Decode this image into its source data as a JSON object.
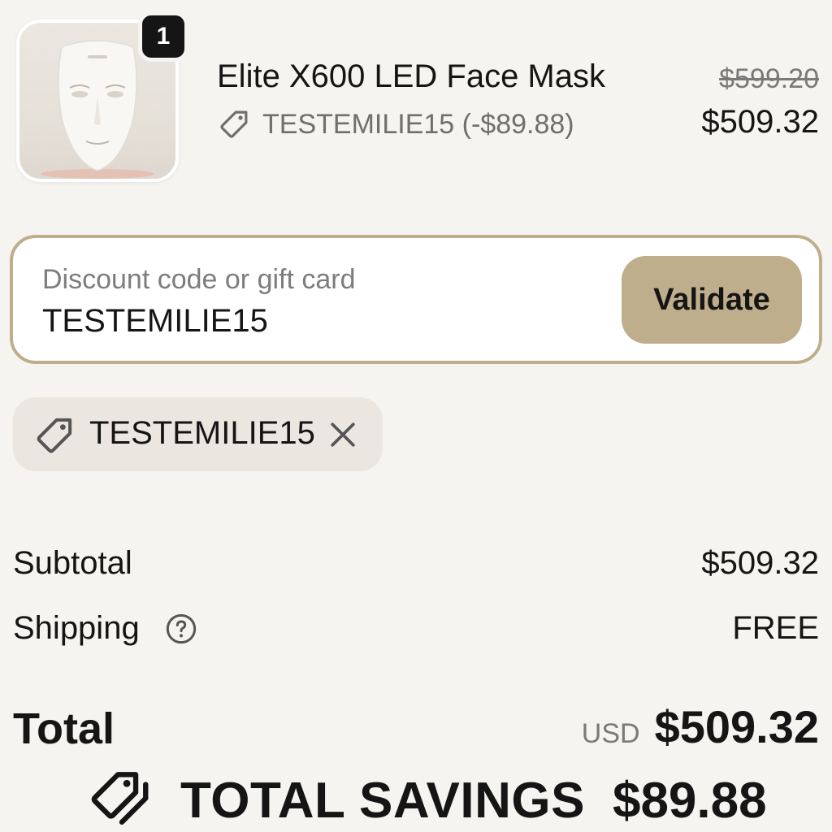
{
  "cart_line": {
    "quantity": "1",
    "product_name": "Elite X600 LED Face Mask",
    "discount_note": "TESTEMILIE15 (-$89.88)",
    "original_price": "$599.20",
    "final_price": "$509.32",
    "image_icon": "led-face-mask-image"
  },
  "discount": {
    "placeholder": "Discount code or gift card",
    "value": "TESTEMILIE15",
    "validate_label": "Validate",
    "applied_code": "TESTEMILIE15"
  },
  "summary": {
    "subtotal_label": "Subtotal",
    "subtotal_value": "$509.32",
    "shipping_label": "Shipping",
    "shipping_value": "FREE",
    "total_label": "Total",
    "currency": "USD",
    "total_value": "$509.32"
  },
  "savings": {
    "label": "TOTAL SAVINGS",
    "value": "$89.88"
  },
  "colors": {
    "background": "#f6f4f0",
    "accent": "#bfae8c",
    "chip": "#ebe7e0",
    "text": "#151515",
    "muted": "#7a7a7a"
  },
  "icons": {
    "discount_tag": "tag-icon",
    "remove": "close-icon",
    "help": "question-circle-icon",
    "savings": "tags-icon"
  }
}
